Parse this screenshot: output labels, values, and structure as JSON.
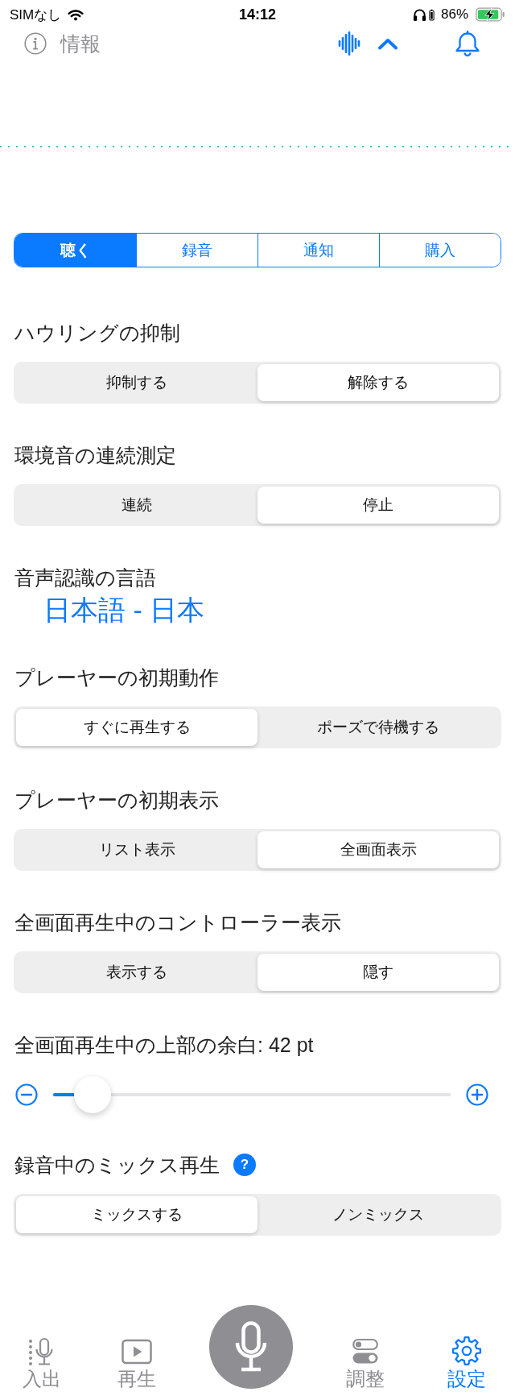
{
  "status_bar": {
    "carrier": "SIMなし",
    "time": "14:12",
    "battery": "86%"
  },
  "header": {
    "info_label": "情報"
  },
  "tabs": [
    {
      "label": "聴く",
      "selected": true
    },
    {
      "label": "録音",
      "selected": false
    },
    {
      "label": "通知",
      "selected": false
    },
    {
      "label": "購入",
      "selected": false
    }
  ],
  "settings": [
    {
      "kind": "segmented",
      "title": "ハウリングの抑制",
      "options": [
        {
          "label": "抑制する",
          "selected": false
        },
        {
          "label": "解除する",
          "selected": true
        }
      ]
    },
    {
      "kind": "segmented",
      "title": "環境音の連続測定",
      "options": [
        {
          "label": "連続",
          "selected": false
        },
        {
          "label": "停止",
          "selected": true
        }
      ]
    },
    {
      "kind": "value",
      "title": "音声認識の言語",
      "value": "日本語 - 日本"
    },
    {
      "kind": "segmented",
      "title": "プレーヤーの初期動作",
      "options": [
        {
          "label": "すぐに再生する",
          "selected": true
        },
        {
          "label": "ポーズで待機する",
          "selected": false
        }
      ]
    },
    {
      "kind": "segmented",
      "title": "プレーヤーの初期表示",
      "options": [
        {
          "label": "リスト表示",
          "selected": false
        },
        {
          "label": "全画面表示",
          "selected": true
        }
      ]
    },
    {
      "kind": "segmented",
      "title": "全画面再生中のコントローラー表示",
      "options": [
        {
          "label": "表示する",
          "selected": false
        },
        {
          "label": "隠す",
          "selected": true
        }
      ]
    },
    {
      "kind": "slider",
      "title": "全画面再生中の上部の余白: 42 pt",
      "level": 0.1
    },
    {
      "kind": "segmented",
      "title": "録音中のミックス再生",
      "help": "?",
      "options": [
        {
          "label": "ミックスする",
          "selected": true
        },
        {
          "label": "ノンミックス",
          "selected": false
        }
      ]
    }
  ],
  "tab_bar": {
    "items": [
      {
        "label": "入出",
        "selected": false
      },
      {
        "label": "再生",
        "selected": false
      },
      {
        "label": "調整",
        "selected": false
      },
      {
        "label": "設定",
        "selected": true
      }
    ]
  }
}
